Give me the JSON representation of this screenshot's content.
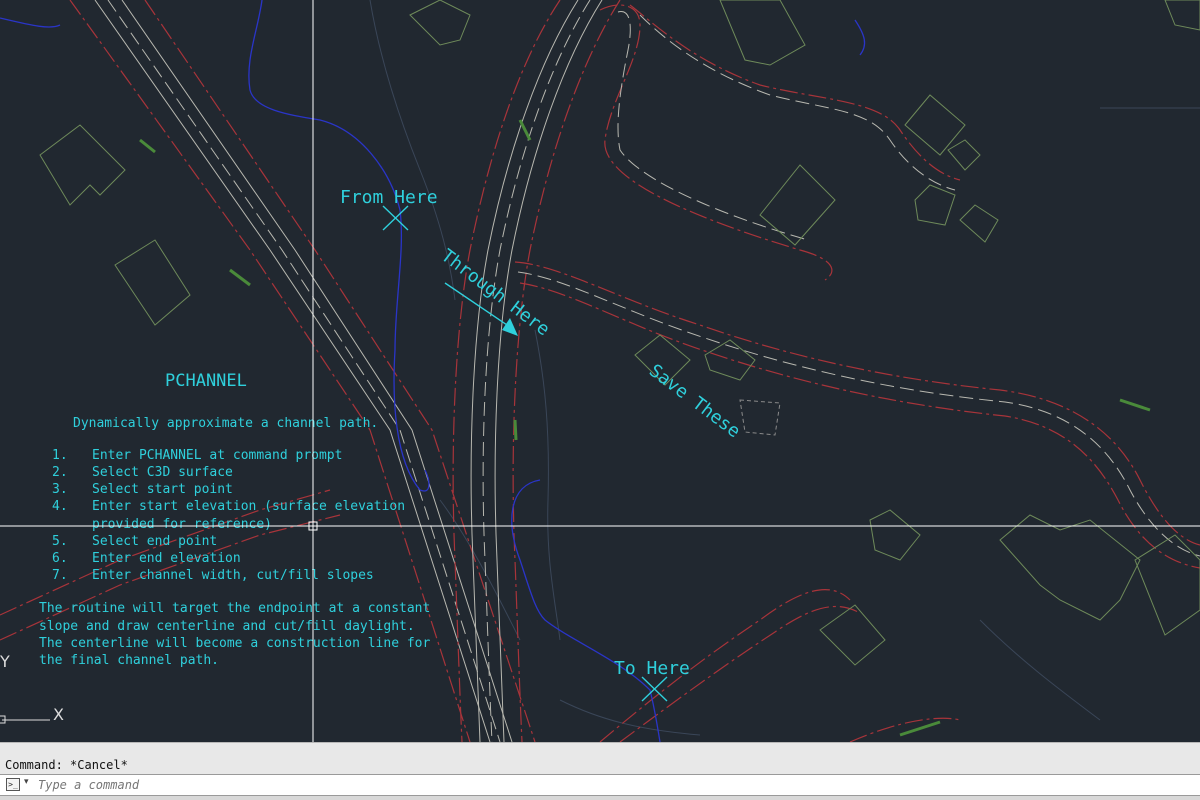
{
  "drawing": {
    "labels": {
      "from": "From Here",
      "through": "Through Here",
      "save": "Save These",
      "to": "To Here"
    },
    "instructions": {
      "title": "PCHANNEL",
      "subtitle": "Dynamically approximate a channel path.",
      "steps": [
        {
          "num": "1.",
          "text": "Enter PCHANNEL at command prompt"
        },
        {
          "num": "2.",
          "text": "Select C3D surface"
        },
        {
          "num": "3.",
          "text": "Select start point"
        },
        {
          "num": "4.",
          "text": "Enter start elevation (surface elevation"
        },
        {
          "num": "",
          "text": "provided for reference)"
        },
        {
          "num": "5.",
          "text": "Select end point"
        },
        {
          "num": "6.",
          "text": "Enter end elevation"
        },
        {
          "num": "7.",
          "text": "Enter channel width, cut/fill slopes"
        }
      ],
      "footer": [
        "The routine will target the endpoint at a constant",
        "slope and draw centerline and cut/fill daylight.",
        "The centerline will become a construction line for",
        "the final channel path."
      ]
    },
    "ucs": {
      "y_label": "Y",
      "x_label": "X"
    },
    "colors": {
      "background": "#212830",
      "annotation": "#2fd0dc",
      "stream": "#2a35c8",
      "road_red": "#a8343a",
      "road_white": "#b8b8b0",
      "building_green": "#6e8a5a",
      "crosshair": "#ffffff"
    }
  },
  "command": {
    "history": "Command: *Cancel*",
    "placeholder": "Type a command",
    "icon": "command-prompt-icon"
  }
}
